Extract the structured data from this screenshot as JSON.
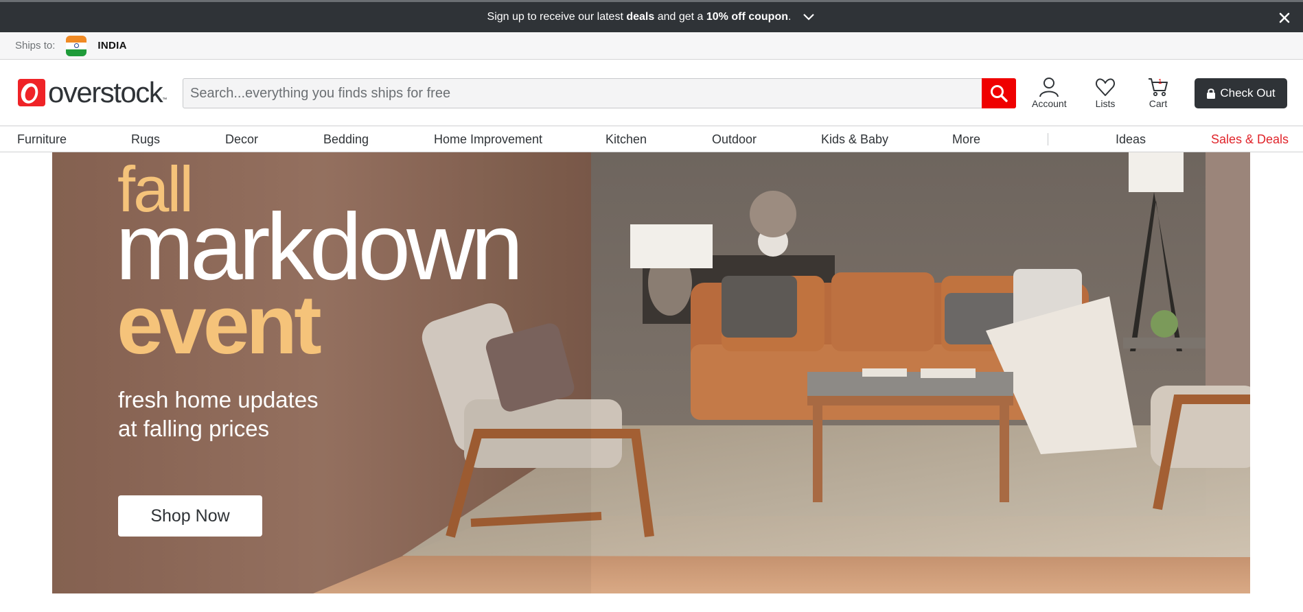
{
  "promo": {
    "text_pre": "Sign up to receive our latest ",
    "text_bold1": "deals",
    "text_mid": " and get a ",
    "text_bold2": "10% off coupon",
    "text_post": ".",
    "expand_icon": "chevron-down-icon",
    "close_icon": "close-icon"
  },
  "ship": {
    "label": "Ships to:",
    "country": "INDIA",
    "flag_icon": "india-flag-icon"
  },
  "header": {
    "logo_text": "overstock",
    "logo_tm": "™",
    "search_placeholder": "Search...everything you finds ships for free",
    "search_value": "",
    "account_label": "Account",
    "lists_label": "Lists",
    "cart_label": "Cart",
    "cart_count": "1",
    "checkout_label": "Check Out"
  },
  "nav": {
    "items": [
      "Furniture",
      "Rugs",
      "Decor",
      "Bedding",
      "Home Improvement",
      "Kitchen",
      "Outdoor",
      "Kids & Baby",
      "More"
    ],
    "ideas": "Ideas",
    "deals": "Sales & Deals"
  },
  "hero": {
    "line1": "fall",
    "line2": "markdown",
    "line3": "event",
    "sub1": "fresh home updates",
    "sub2": "at falling prices",
    "cta": "Shop Now"
  },
  "colors": {
    "brand_red": "#ef2327",
    "dark": "#2f3337",
    "accent_gold": "#f5c37a",
    "deals_red": "#e0242a"
  }
}
